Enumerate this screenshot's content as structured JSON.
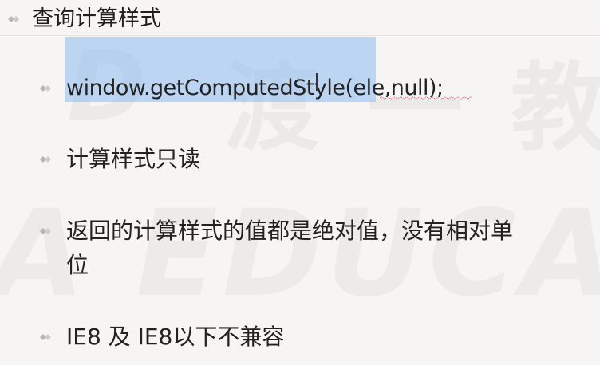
{
  "slide": {
    "heading": "查询计算样式",
    "bullets": [
      {
        "text": "window.getComputedStyle(ele,null);"
      },
      {
        "text": "计算样式只读"
      },
      {
        "text_line1": "返回的计算样式的值都是绝对值，没有相对单",
        "text_line2": "位"
      },
      {
        "text": "IE8 及 IE8以下不兼容"
      }
    ]
  },
  "colors": {
    "background": "#f7f5f3",
    "bullet": "#b9b6b2",
    "selection": "#8cb9f0",
    "spellcheck_underline": "#d24a4a"
  },
  "watermark": {
    "cn": "渡一教",
    "en": "A EDUCAT",
    "logo": "D"
  }
}
